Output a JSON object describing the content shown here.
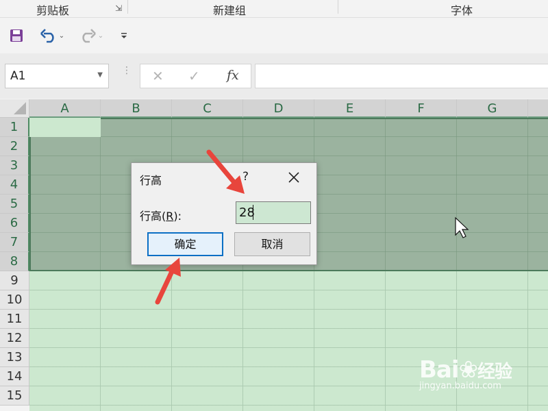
{
  "ribbon": {
    "groups": [
      "剪贴板",
      "新建组",
      "字体"
    ]
  },
  "quick_access": {
    "save_icon": "save-icon",
    "undo_icon": "undo-icon",
    "redo_icon": "redo-icon",
    "customize_icon": "customize-qat-icon"
  },
  "formula_bar": {
    "name_box_value": "A1",
    "cancel_glyph": "✕",
    "enter_glyph": "✓",
    "fx_label": "fx",
    "formula_value": ""
  },
  "sheet": {
    "columns": [
      "A",
      "B",
      "C",
      "D",
      "E",
      "F",
      "G"
    ],
    "rows": [
      "1",
      "2",
      "3",
      "4",
      "5",
      "6",
      "7",
      "8",
      "9",
      "10",
      "11",
      "12",
      "13",
      "14",
      "15"
    ],
    "selected_rows": 8
  },
  "dialog": {
    "title": "行高",
    "help": "?",
    "field_label_prefix": "行高(",
    "field_label_key": "R",
    "field_label_suffix": "):",
    "field_value": "28",
    "ok_label": "确定",
    "cancel_label": "取消"
  },
  "colors": {
    "selection": "#9bb39f",
    "sheet_bg": "#cce8cf",
    "arrow": "#e8453c"
  },
  "watermark": {
    "logo_left": "Bai",
    "logo_right": "经验",
    "url": "jingyan.baidu.com"
  }
}
